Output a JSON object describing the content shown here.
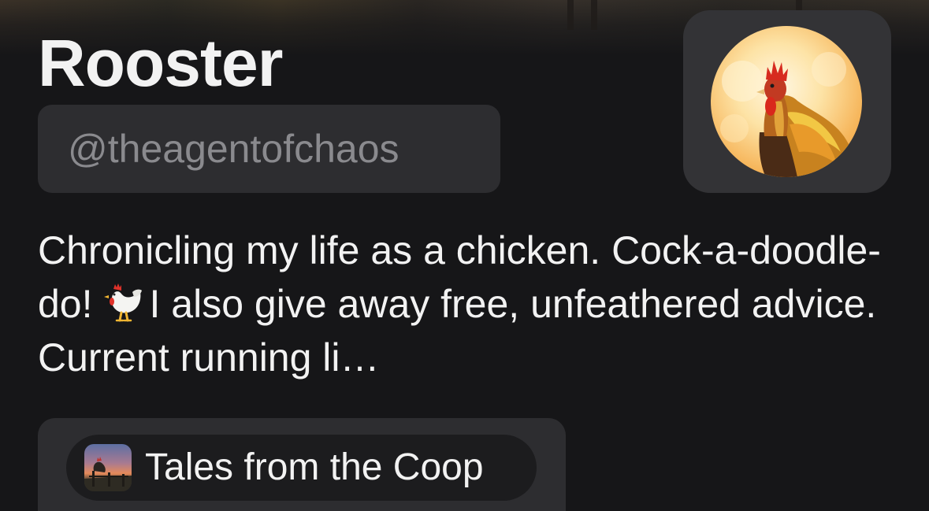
{
  "profile": {
    "display_name": "Rooster",
    "handle": "@theagentofchaos",
    "bio_before_emoji": "Chronicling my life as a chicken. Cock-a-doodle-do!",
    "bio_emoji": "rooster-emoji-icon",
    "bio_after_emoji": "I also give away free, unfeathered advice. Current running li…",
    "avatar_icon": "rooster-avatar-icon"
  },
  "publication": {
    "name": "Tales from the Coop",
    "thumbnail_icon": "rooster-sunset-thumbnail-icon"
  },
  "colors": {
    "background": "#161618",
    "card": "#2d2d30",
    "chip": "#1c1c1e",
    "text": "#f2f2f2",
    "muted_text": "#8a8a8e"
  }
}
